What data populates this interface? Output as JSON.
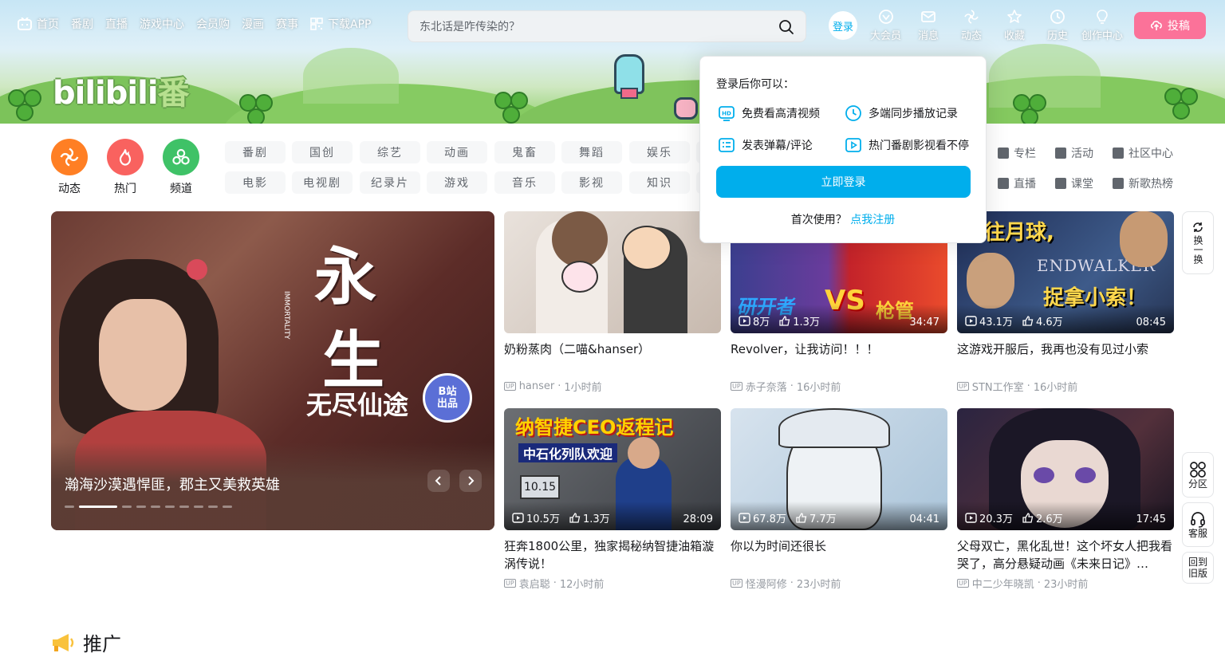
{
  "top_nav": {
    "items": [
      "首页",
      "番剧",
      "直播",
      "游戏中心",
      "会员购",
      "漫画",
      "赛事",
      "下载APP"
    ]
  },
  "search": {
    "placeholder": "东北话是咋传染的？"
  },
  "header_right": {
    "login": "登录",
    "items": [
      "大会员",
      "消息",
      "动态",
      "收藏",
      "历史",
      "创作中心"
    ],
    "upload": "投稿"
  },
  "logo": {
    "text": "bilibili",
    "suffix": "番"
  },
  "circle_channels": [
    {
      "label": "动态",
      "color": "#ff7f24"
    },
    {
      "label": "热门",
      "color": "#f9625f"
    },
    {
      "label": "频道",
      "color": "#3fc267"
    }
  ],
  "channel_tags": {
    "row1": [
      "番剧",
      "国创",
      "综艺",
      "动画",
      "鬼畜",
      "舞蹈",
      "娱乐"
    ],
    "row2": [
      "电影",
      "电视剧",
      "纪录片",
      "游戏",
      "音乐",
      "影视",
      "知识"
    ]
  },
  "side_links": {
    "row1": [
      "专栏",
      "活动",
      "社区中心"
    ],
    "row2": [
      "直播",
      "课堂",
      "新歌热榜"
    ]
  },
  "carousel": {
    "caption": "瀚海沙漠遇悍匪，郡主又美救英雄",
    "slides": 10,
    "active_index": 1,
    "poster_title_1": "永",
    "poster_title_2": "生",
    "poster_sub": "无尽仙途",
    "poster_en": "IMMORTALITY",
    "badge_1": "B站",
    "badge_2": "出品"
  },
  "videos": [
    {
      "title": "奶粉蒸肉（二喵&hanser）",
      "author": "hanser",
      "time": "1小时前",
      "views": "",
      "likes": "",
      "duration": ""
    },
    {
      "title": "Revolver，让我访问！！！",
      "author": "赤子奈落",
      "time": "16小时前",
      "views": "8万",
      "likes": "1.3万",
      "duration": "34:47"
    },
    {
      "title": "这游戏开服后，我再也没有见过小索",
      "author": "STN工作室",
      "time": "16小时前",
      "views": "43.1万",
      "likes": "4.6万",
      "duration": "08:45"
    },
    {
      "title": "狂奔1800公里，独家揭秘纳智捷油箱漩涡传说！",
      "author": "袁启聪",
      "time": "12小时前",
      "views": "10.5万",
      "likes": "1.3万",
      "duration": "28:09"
    },
    {
      "title": "你以为时间还很长",
      "author": "怪漫阿修",
      "time": "23小时前",
      "views": "67.8万",
      "likes": "7.7万",
      "duration": "04:41"
    },
    {
      "title": "父母双亡，黑化乱世！这个坏女人把我看哭了，高分悬疑动画《未来日记》…",
      "author": "中二少年晓凯",
      "time": "23小时前",
      "views": "20.3万",
      "likes": "2.6万",
      "duration": "17:45"
    }
  ],
  "thumb_text": {
    "v3_line1": "前往月球,",
    "v3_line2": "ENDWALKER",
    "v3_line3": "捉拿小索！",
    "v4_line1": "纳智捷CEO返程记",
    "v4_line2": "中石化列队欢迎",
    "v4_pump": "10.15",
    "v2_vs": "VS",
    "v2_right": "枪管"
  },
  "login_popover": {
    "title": "登录后你可以：",
    "features": [
      "免费看高清视频",
      "多端同步播放记录",
      "发表弹幕/评论",
      "热门番剧影视看不停"
    ],
    "button": "立即登录",
    "first_time": "首次使用？",
    "register": "点我注册"
  },
  "refresh": {
    "label": "换一换"
  },
  "float_buttons": [
    "分区",
    "客服",
    "回到旧版"
  ],
  "section": {
    "promo_title": "推广"
  }
}
